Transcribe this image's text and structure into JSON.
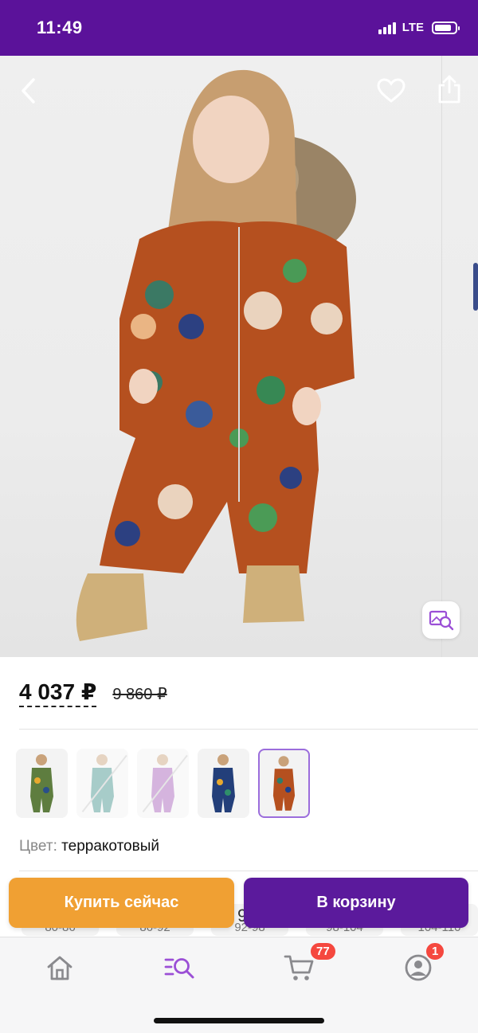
{
  "status_bar": {
    "time": "11:49",
    "network": "LTE"
  },
  "product": {
    "price": "4 037 ₽",
    "old_price": "9 860 ₽",
    "color_label": "Цвет:",
    "color_value": "терракотовый",
    "variant_count": 5,
    "selected_variant": 5
  },
  "sizes": [
    "80-86",
    "86-92",
    "92-98",
    "98-104",
    "104-110"
  ],
  "size_peek_text": "9",
  "actions": {
    "buy_now": "Купить сейчас",
    "add_to_cart": "В корзину"
  },
  "tab_bar": {
    "items": [
      {
        "name": "home",
        "icon": "home-icon"
      },
      {
        "name": "catalog",
        "icon": "search-list-icon",
        "active": true
      },
      {
        "name": "cart",
        "icon": "cart-icon",
        "badge": "77"
      },
      {
        "name": "profile",
        "icon": "profile-icon",
        "badge": "1"
      }
    ]
  },
  "colors": {
    "brand": "#5b129a",
    "buy": "#f0a033",
    "cart": "#5b1a9c",
    "badge": "#f5483f",
    "active_tab": "#9b4fd6"
  }
}
